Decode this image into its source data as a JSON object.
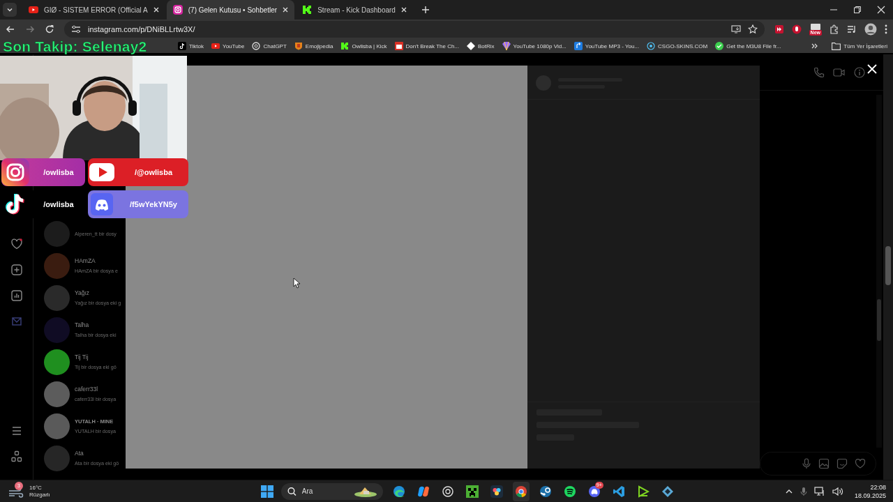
{
  "browser": {
    "tabs": [
      {
        "title": "GIØ - SISTEM ERROR (Official A",
        "selected": false
      },
      {
        "title": "(7) Gelen Kutusu • Sohbetler",
        "selected": true
      },
      {
        "title": "Stream - Kick Dashboard",
        "selected": false
      }
    ],
    "address": "instagram.com/p/DNiBLLrtw3X/",
    "bookmarks": [
      "Tiktok",
      "YouTube",
      "ChatGPT",
      "Emojipedia",
      "Owlisba | Kick",
      "Don't Break The Ch...",
      "BotRix",
      "YouTube 1080p Vid...",
      "YouTube MP3 - You...",
      "CSGO-SKINS.COM",
      "Get the M3U8 File fr..."
    ],
    "all_bookmarks": "Tüm Yer İşaretleri",
    "extension_badge": "New"
  },
  "stream_overlay": {
    "last_follower": "Son Takip: Selenay2",
    "socials": [
      {
        "kind": "instagram",
        "handle": "/owlisba"
      },
      {
        "kind": "youtube",
        "handle": "/@owlisba"
      },
      {
        "kind": "tiktok",
        "handle": "/owlisba"
      },
      {
        "kind": "discord",
        "handle": "/f5wYekYN5y"
      }
    ]
  },
  "messages": [
    {
      "preview": "Alperen_tt bir dosy"
    },
    {
      "name": "HAmZA",
      "preview": "HAmZA bir dosya e"
    },
    {
      "name": "Yağız",
      "preview": "Yağız bir dosya eki g"
    },
    {
      "name": "Talha",
      "preview": "Talha bir dosya eki"
    },
    {
      "name": "Tij Tij",
      "preview": "Tij bir dosya eki gö"
    },
    {
      "name": "caferr33l",
      "preview": "caferr33l bir dosya"
    },
    {
      "name": "YUTALH · MINE",
      "preview": "YUTALH bir dosya"
    },
    {
      "name": "Ata",
      "preview": "Ata bir dosya eki gö"
    }
  ],
  "taskbar": {
    "weather": {
      "alert_count": "3",
      "temperature": "16°C",
      "condition": "Rüzgarlı"
    },
    "search": {
      "placeholder": "Ara"
    },
    "discord_badge": "9+",
    "clock": {
      "time": "22:08",
      "date": "18.09.2025"
    }
  }
}
